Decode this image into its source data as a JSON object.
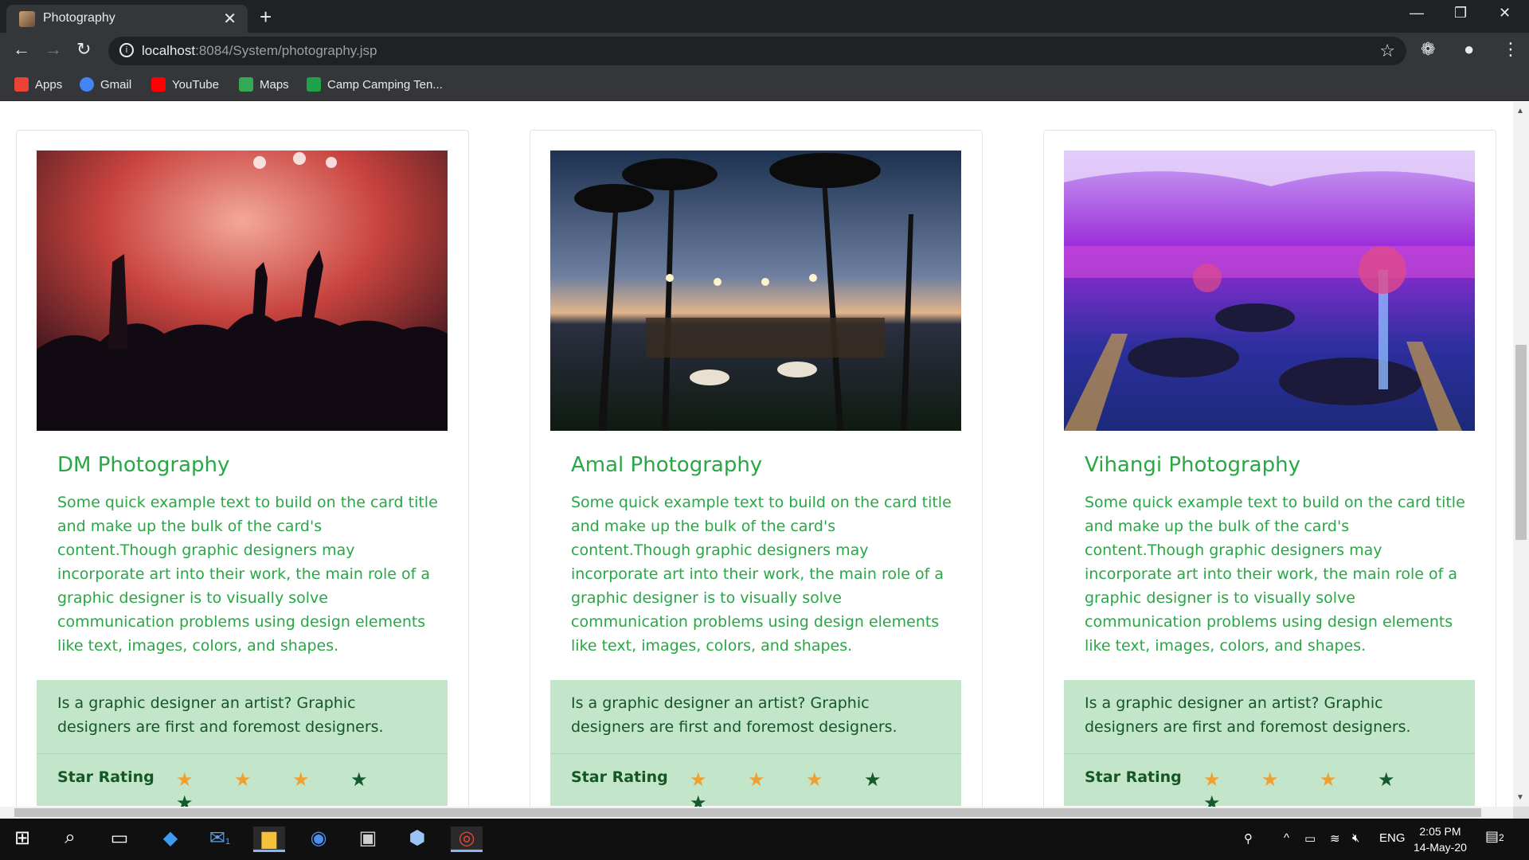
{
  "browser": {
    "tab_title": "Photography",
    "url_host": "localhost",
    "url_path": ":8084/System/photography.jsp",
    "bookmarks": [
      {
        "label": "Apps",
        "icon": "apps-grid-icon",
        "color": "#ea4335"
      },
      {
        "label": "Gmail",
        "icon": "google-icon",
        "color": "#4285f4"
      },
      {
        "label": "YouTube",
        "icon": "youtube-icon",
        "color": "#ff0000"
      },
      {
        "label": "Maps",
        "icon": "maps-icon",
        "color": "#34a853"
      },
      {
        "label": "Camp Camping Ten...",
        "icon": "px-icon",
        "color": "#1fa34a"
      }
    ]
  },
  "cards": [
    {
      "title": "DM Photography",
      "text": "Some quick example text to build on the card title and make up the bulk of the card's content.Though graphic designers may incorporate art into their work, the main role of a graphic designer is to visually solve communication problems using design elements like text, images, colors, and shapes.",
      "quote": "Is a graphic designer an artist? Graphic designers are first and foremost designers.",
      "rating_label": "Star Rating",
      "rating": 3,
      "stars_total": 5,
      "image": "concert-crowd-photo"
    },
    {
      "title": "Amal Photography",
      "text": "Some quick example text to build on the card title and make up the bulk of the card's content.Though graphic designers may incorporate art into their work, the main role of a graphic designer is to visually solve communication problems using design elements like text, images, colors, and shapes.",
      "quote": "Is a graphic designer an artist? Graphic designers are first and foremost designers.",
      "rating_label": "Star Rating",
      "rating": 3,
      "stars_total": 5,
      "image": "beach-event-photo"
    },
    {
      "title": "Vihangi Photography",
      "text": "Some quick example text to build on the card title and make up the bulk of the card's content.Though graphic designers may incorporate art into their work, the main role of a graphic designer is to visually solve communication problems using design elements like text, images, colors, and shapes.",
      "quote": "Is a graphic designer an artist? Graphic designers are first and foremost designers.",
      "rating_label": "Star Rating",
      "rating": 3,
      "stars_total": 5,
      "image": "banquet-hall-photo"
    }
  ],
  "colors": {
    "accent_green": "#28a745",
    "footer_bg": "#c3e6cb",
    "star_on": "#f0a030",
    "star_off": "#145a2a"
  },
  "taskbar": {
    "language": "ENG",
    "time": "2:05 PM",
    "date": "14-May-20",
    "notification_count": "2",
    "mail_badge": "1"
  }
}
